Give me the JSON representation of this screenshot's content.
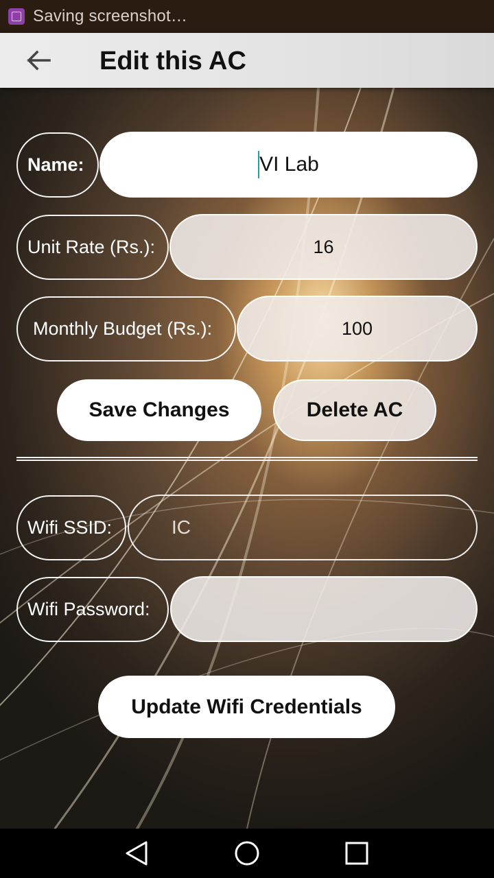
{
  "status_bar": {
    "notification_icon": "screenshot-icon",
    "text": "Saving screenshot…"
  },
  "app_bar": {
    "back_icon": "arrow-left-icon",
    "title": "Edit this AC"
  },
  "form": {
    "name": {
      "label": "Name:",
      "value": "VI Lab"
    },
    "unit_rate": {
      "label": "Unit Rate (Rs.):",
      "value": "16"
    },
    "monthly_budget": {
      "label": "Monthly Budget (Rs.):",
      "value": "100"
    },
    "save_label": "Save Changes",
    "delete_label": "Delete AC"
  },
  "wifi": {
    "ssid": {
      "label": "Wifi SSID:",
      "value": "IC"
    },
    "password": {
      "label": "Wifi Password:",
      "value": ""
    },
    "update_label": "Update Wifi Credentials"
  },
  "nav_bar": {
    "icons": [
      "back-triangle-icon",
      "home-circle-icon",
      "recents-square-icon"
    ]
  }
}
